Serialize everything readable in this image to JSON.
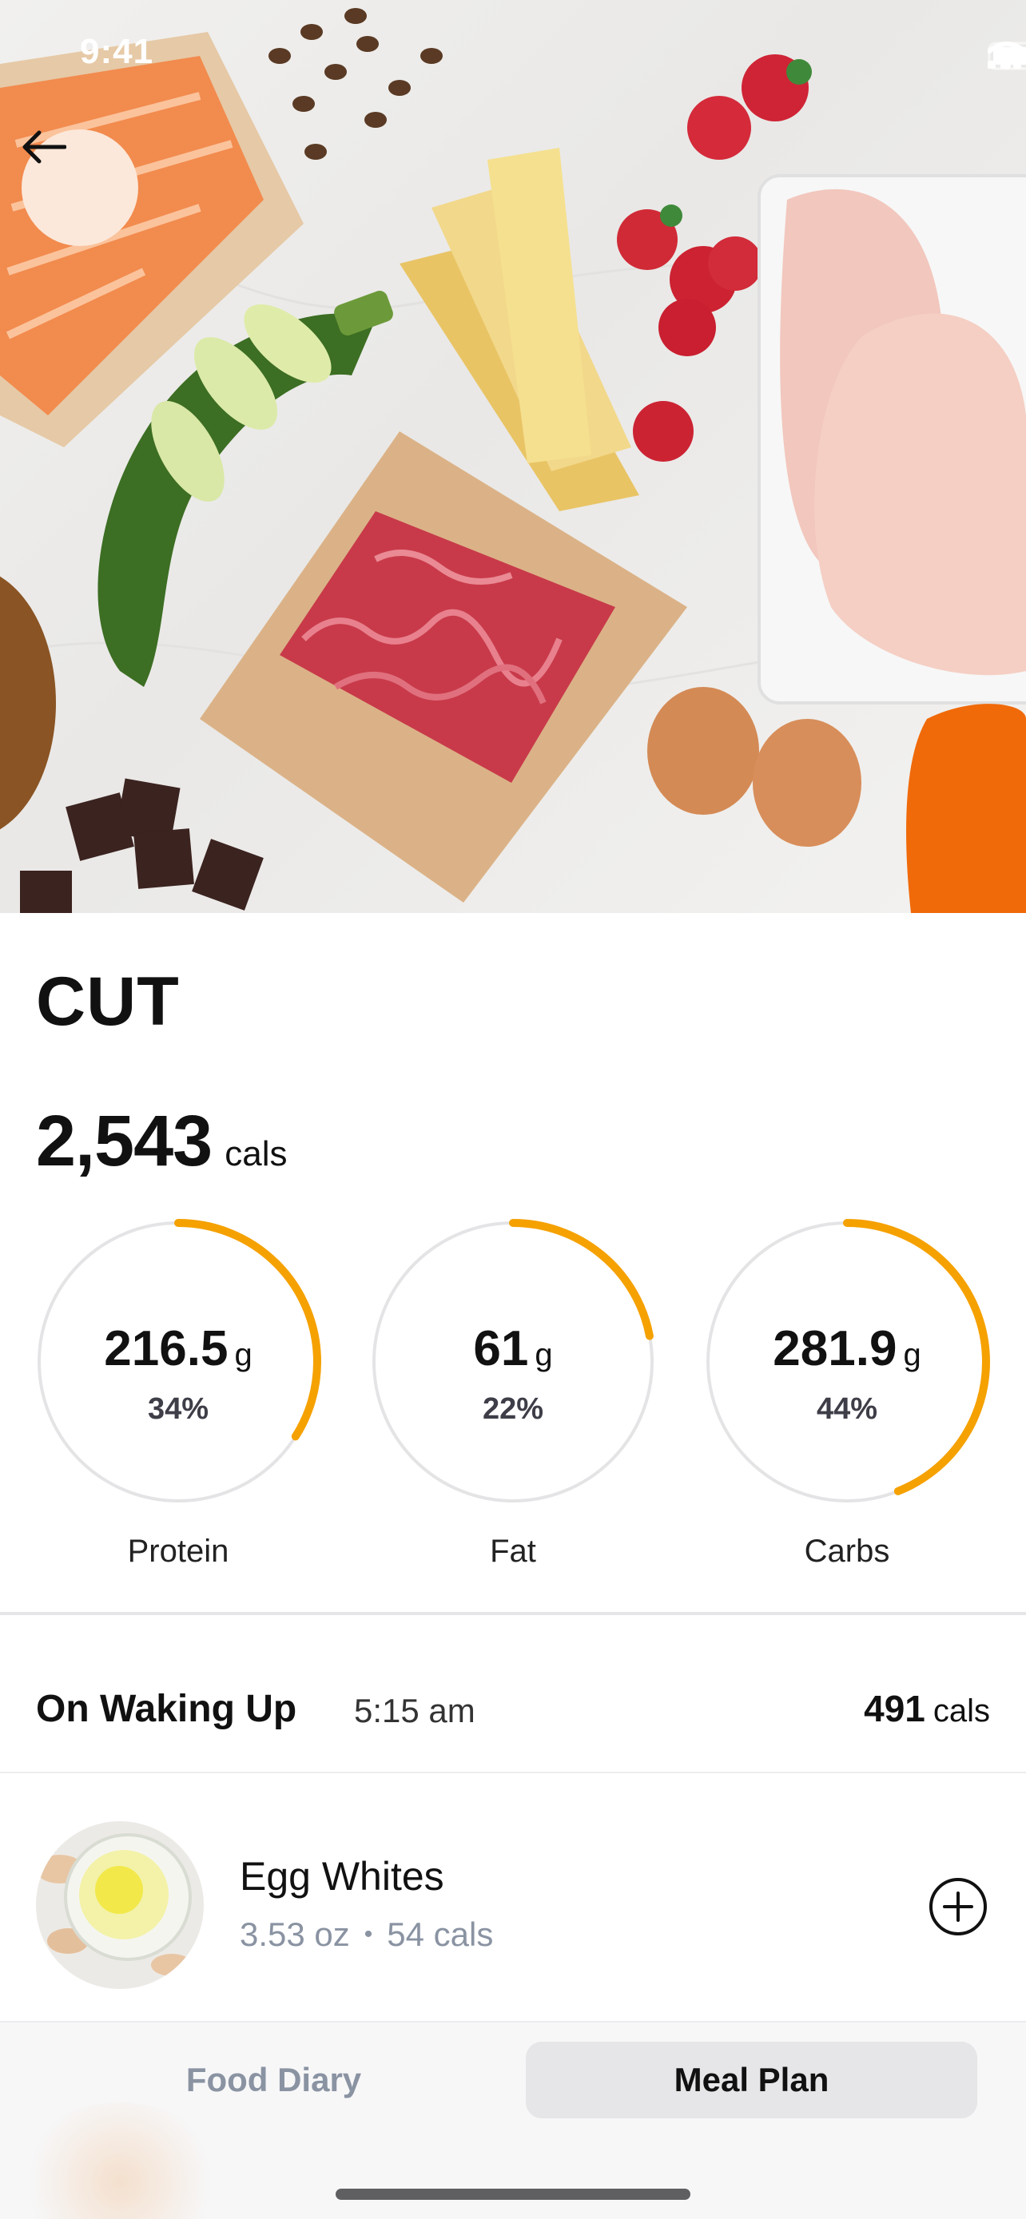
{
  "status_bar": {
    "time": "9:41"
  },
  "plan": {
    "title": "CUT",
    "calories": "2,543",
    "calories_unit": "cals"
  },
  "macros": [
    {
      "name": "Protein",
      "amount": "216.5",
      "unit": "g",
      "percent": "34%",
      "fraction": 0.34
    },
    {
      "name": "Fat",
      "amount": "61",
      "unit": "g",
      "percent": "22%",
      "fraction": 0.22
    },
    {
      "name": "Carbs",
      "amount": "281.9",
      "unit": "g",
      "percent": "44%",
      "fraction": 0.44
    }
  ],
  "meal": {
    "name": "On Waking Up",
    "time": "5:15 am",
    "calories": "491",
    "calories_unit": "cals",
    "items": [
      {
        "name": "Egg Whites",
        "amount": "3.53 oz",
        "separator": "•",
        "calories": "54 cals"
      }
    ]
  },
  "tabs": {
    "food_diary": "Food Diary",
    "meal_plan": "Meal Plan",
    "active": "Meal Plan"
  },
  "colors": {
    "accent": "#F5A100",
    "ring_track": "#E4E4E6",
    "muted_text": "#8A93A2"
  },
  "icons": [
    "back-arrow-icon",
    "signal-icon",
    "wifi-icon",
    "battery-icon",
    "add-circle-icon"
  ]
}
